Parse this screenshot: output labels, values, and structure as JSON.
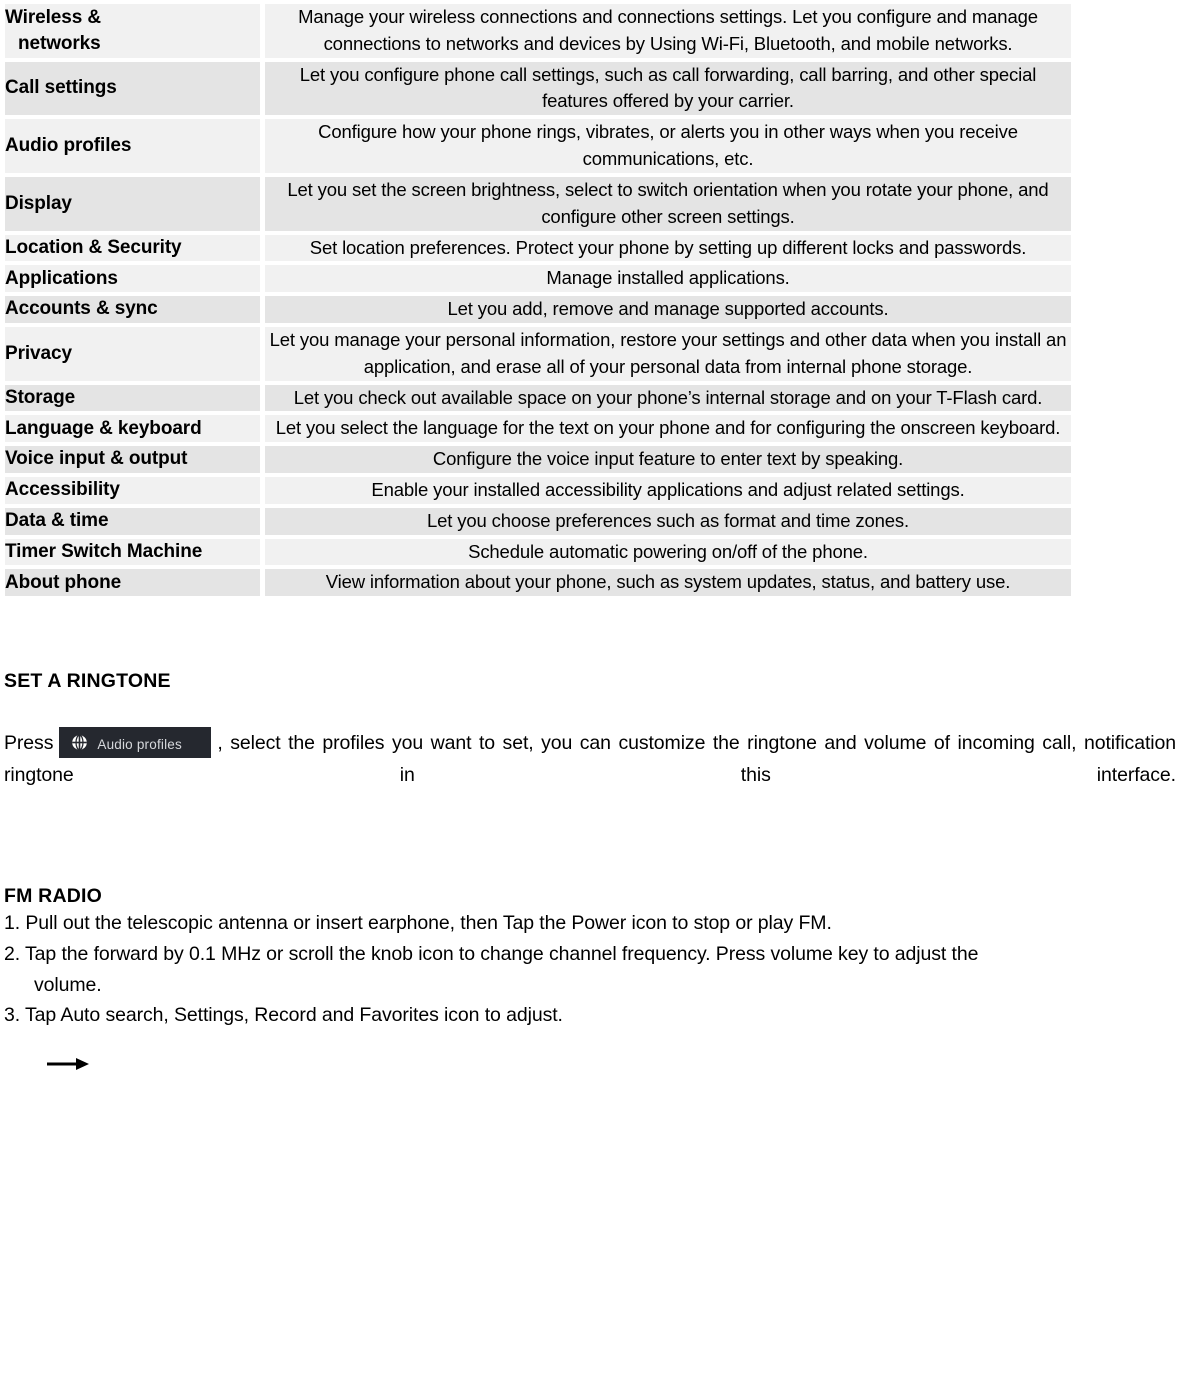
{
  "settings_table": {
    "rows": [
      {
        "label": "Wireless &",
        "label_line2": "networks",
        "description": "Manage your wireless connections and connections settings. Let you configure and manage connections to networks and devices by Using Wi-Fi, Bluetooth, and mobile networks.",
        "shade": "light"
      },
      {
        "label": "Call settings",
        "description": "Let you configure phone call settings, such as call forwarding, call barring, and other special features offered by your carrier.",
        "shade": "dark"
      },
      {
        "label": "Audio profiles",
        "description": "Configure how your phone rings, vibrates, or alerts you in other ways when you receive communications, etc.",
        "shade": "light"
      },
      {
        "label": "Display",
        "description": "Let you set the screen brightness, select to switch orientation when you rotate your phone, and configure other screen settings.",
        "shade": "dark"
      },
      {
        "label": "Location & Security",
        "description": "Set location preferences. Protect your phone by setting up different locks and passwords.",
        "shade": "light"
      },
      {
        "label": "Applications",
        "description": "Manage installed applications.",
        "shade": "light"
      },
      {
        "label": "Accounts & sync",
        "description": "Let you add, remove and manage supported accounts.",
        "shade": "dark"
      },
      {
        "label": "Privacy",
        "description": "Let you manage your personal information, restore your settings and other data when you install an application, and erase all of your personal data from internal phone storage.",
        "shade": "light"
      },
      {
        "label": "Storage",
        "description": "Let you check out available space on your phone’s internal storage and on your T-Flash card.",
        "shade": "dark"
      },
      {
        "label": "Language & keyboard",
        "description": "Let you select the language for the text on your phone and for configuring the onscreen keyboard.",
        "shade": "light"
      },
      {
        "label": "Voice input & output",
        "description": "Configure the voice input feature to enter text by speaking.",
        "shade": "dark"
      },
      {
        "label": "Accessibility",
        "description": "Enable your installed accessibility applications and adjust related settings.",
        "shade": "light"
      },
      {
        "label": "Data & time",
        "description": "Let you choose preferences such as format and time zones.",
        "shade": "dark"
      },
      {
        "label": "Timer Switch Machine",
        "description": "Schedule automatic powering on/off of the phone.",
        "shade": "light"
      },
      {
        "label": "About phone",
        "description": "View information about your phone, such as system updates, status, and battery use.",
        "shade": "dark"
      }
    ]
  },
  "ringtone_section": {
    "heading": "SET A RINGTONE",
    "text_before": "Press",
    "chip_label": "Audio profiles",
    "chip_icon": "audio-profiles-sphere-icon",
    "chip_background": "#25282f",
    "arrow_icon": "right-arrow-icon",
    "text_after": ", select the profiles you want to set, you can customize the ringtone and volume of incoming call, notification ringtone in this interface."
  },
  "fm_radio_section": {
    "heading": "FM RADIO",
    "steps": [
      "1. Pull out the telescopic antenna or insert earphone, then Tap the Power icon to stop or play FM.",
      "2. Tap the forward by 0.1 MHz or scroll the knob icon to change channel frequency. Press volume key to adjust the",
      "volume.",
      "3. Tap Auto search, Settings, Record and Favorites icon to adjust."
    ]
  }
}
